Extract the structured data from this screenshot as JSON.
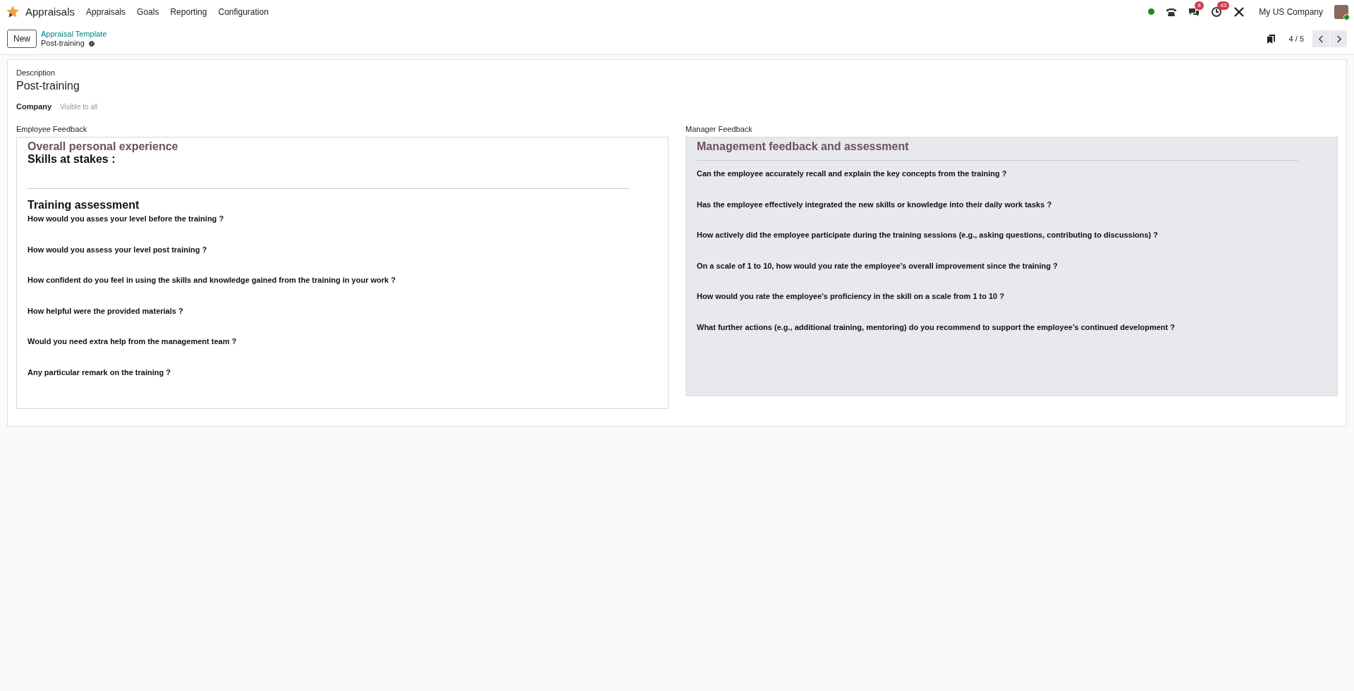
{
  "navbar": {
    "app_name": "Appraisals",
    "menus": [
      "Appraisals",
      "Goals",
      "Reporting",
      "Configuration"
    ],
    "messages_badge": "8",
    "activities_badge": "43",
    "company": "My US Company"
  },
  "control_panel": {
    "new_button": "New",
    "breadcrumb": "Appraisal Template",
    "record_name": "Post-training",
    "pager": "4 / 5"
  },
  "form": {
    "description_label": "Description",
    "description": "Post-training",
    "company_label": "Company",
    "company_placeholder": "Visible to all",
    "employee_feedback": {
      "label": "Employee Feedback",
      "title": "Overall personal experience",
      "subtitle": "Skills at stakes :",
      "section": "Training assessment",
      "questions": [
        "How would you asses your level before the training ?",
        "How would you assess your level post training ?",
        "How confident do you feel in using the skills and knowledge gained from the training in your work ?",
        "How helpful were the provided materials ?",
        "Would you need extra help from the management team ?",
        "Any particular remark on the training ?"
      ]
    },
    "manager_feedback": {
      "label": "Manager Feedback",
      "title": "Management feedback and assessment",
      "questions": [
        "Can the employee accurately recall and explain the key concepts from the training ?",
        "Has the employee effectively integrated the new skills or knowledge into their daily work tasks ?",
        "How actively did the employee participate during the training sessions (e.g., asking questions, contributing to discussions) ?",
        "On a scale of 1 to 10, how would you rate the employee’s overall improvement since the training ?",
        "How would you rate the employee's proficiency in the skill on a scale from 1 to 10 ?",
        "What further actions (e.g., additional training, mentoring) do you recommend to support the employee’s continued development ?"
      ]
    }
  }
}
